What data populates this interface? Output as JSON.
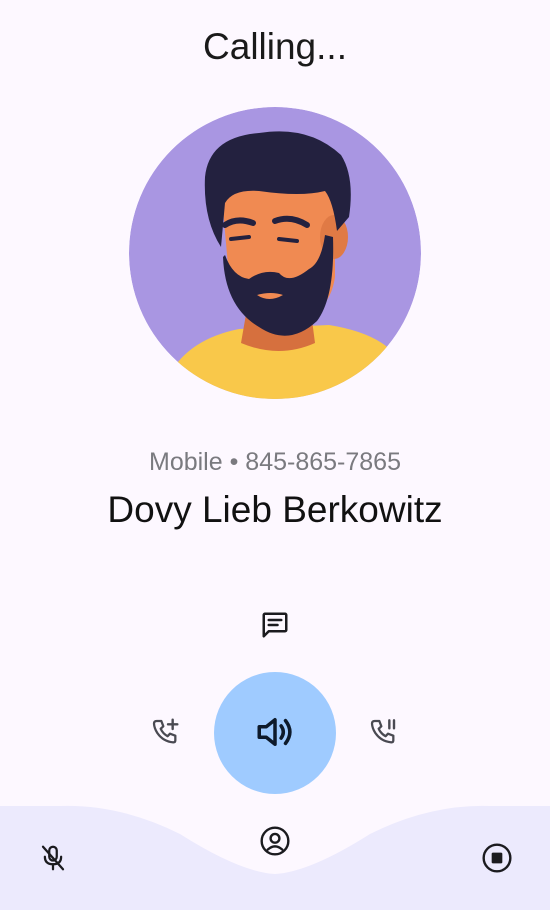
{
  "call": {
    "status": "Calling...",
    "subtitle": "Mobile • 845-865-7865",
    "contact_name": "Dovy Lieb Berkowitz"
  },
  "controls": {
    "message": "message-icon",
    "add_call": "add-call-icon",
    "speaker": "speaker-icon",
    "hold": "hold-call-icon",
    "mute": "mic-off-icon",
    "contact": "account-circle-icon",
    "record": "stop-record-icon"
  },
  "colors": {
    "background": "#fdf8ff",
    "speaker_button": "#9fcbff",
    "bottom_panel": "#eceafd",
    "avatar_bg": "#a996e2",
    "shirt": "#f9c84a",
    "hair": "#23213f",
    "skin": "#f08a52"
  }
}
